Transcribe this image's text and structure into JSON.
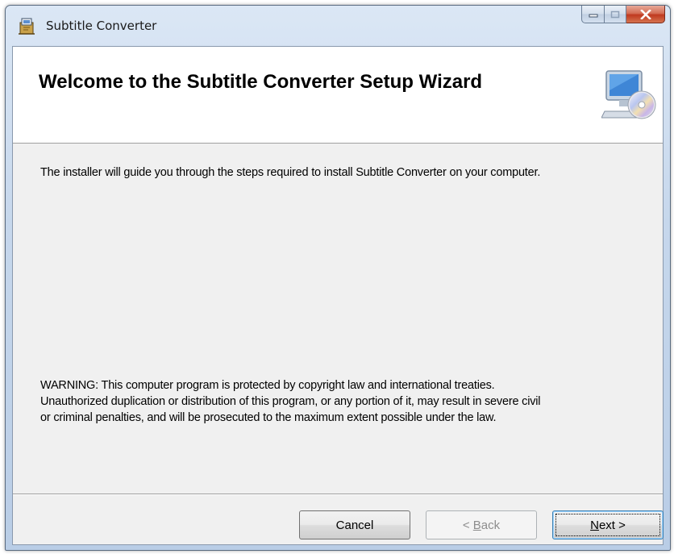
{
  "window": {
    "title": "Subtitle Converter",
    "icons": {
      "app": "installer-box-icon",
      "minimize": "minimize-icon",
      "maximize": "maximize-icon",
      "close": "close-icon"
    }
  },
  "banner": {
    "title": "Welcome to the Subtitle Converter Setup Wizard",
    "icon": "computer-cd-icon"
  },
  "body": {
    "intro": "The installer will guide you through the steps required to install Subtitle Converter on your computer.",
    "warning_lines": [
      "WARNING: This computer program is protected by copyright law and international treaties.",
      "Unauthorized duplication or distribution of this program, or any portion of it, may result in severe civil",
      "or criminal penalties, and will be prosecuted to the maximum extent possible under the law."
    ]
  },
  "buttons": {
    "cancel": "Cancel",
    "back_prefix": "< ",
    "back_mnemonic": "B",
    "back_rest": "ack",
    "next_mnemonic": "N",
    "next_rest": "ext >"
  },
  "colors": {
    "title_bar": "#c6d7ec",
    "client_background": "#f0f0f0",
    "close_button": "#c0391f",
    "default_button_border": "#3c7fb1"
  }
}
